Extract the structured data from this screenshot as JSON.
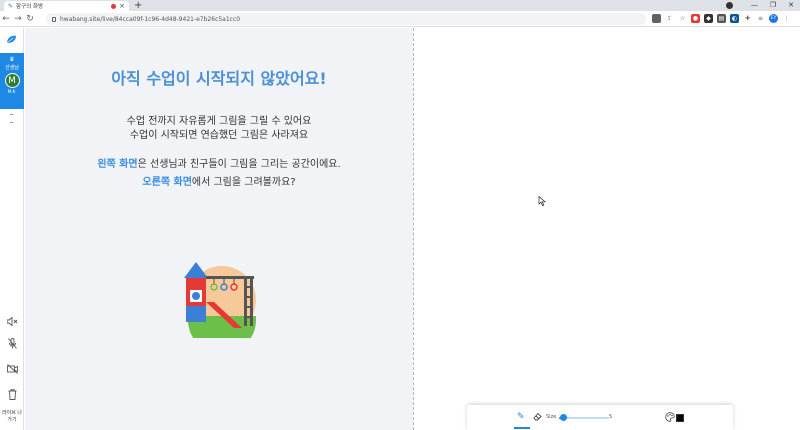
{
  "browser": {
    "tab_title": "함구의 화방",
    "new_tab": "+",
    "url": "hwabang.site/live/84cca09f-1c96-4d48-9421-e7b26c5a1cc0",
    "profile_initials": "EY"
  },
  "sidebar": {
    "teacher_label": "선생님",
    "avatar_letter": "M",
    "initials": "MK",
    "exit_label": "라이브 나가기"
  },
  "main": {
    "headline": "아직 수업이 시작되지 않았어요!",
    "desc_line1": "수업 전까지 자유롭게 그림을 그릴 수 있어요",
    "desc_line2": "수업이 시작되면 연습했던 그림은 사라져요",
    "left_highlight": "왼쪽 화면",
    "left_rest": "은 선생님과 친구들이 그림을 그리는 공간이에요.",
    "right_highlight": "오른쪽 화면",
    "right_rest": "에서 그림을 그려볼까요?"
  },
  "draw_toolbar": {
    "size_label": "Size",
    "size_value": "5",
    "size_fraction": 0.08,
    "brush_color": "#000000"
  },
  "colors": {
    "accent": "#1e88e5",
    "headline": "#4a90d9",
    "left_bg": "#f1f3f6"
  }
}
